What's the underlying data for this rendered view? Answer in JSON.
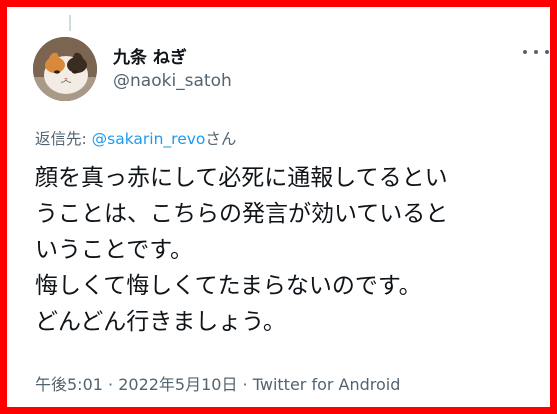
{
  "author": {
    "display_name": "九条 ねぎ",
    "handle": "@naoki_satoh"
  },
  "reply": {
    "prefix": "返信先: ",
    "mention": "@sakarin_revo",
    "suffix": "さん"
  },
  "tweet": {
    "lines": [
      "顔を真っ赤にして必死に通報してるとい",
      "うことは、こちらの発言が効いていると",
      "いうことです。",
      "悔しくて悔しくてたまらないのです。",
      "どんどん行きましょう。"
    ]
  },
  "meta": {
    "time": "午後5:01",
    "sep1": " · ",
    "date": "2022年5月10日",
    "sep2": " · ",
    "source": "Twitter for Android"
  },
  "colors": {
    "frame": "#ff0000",
    "accent": "#1d9bf0",
    "secondary_text": "#536471"
  },
  "icons": {
    "more": "more-horizontal-icon"
  }
}
